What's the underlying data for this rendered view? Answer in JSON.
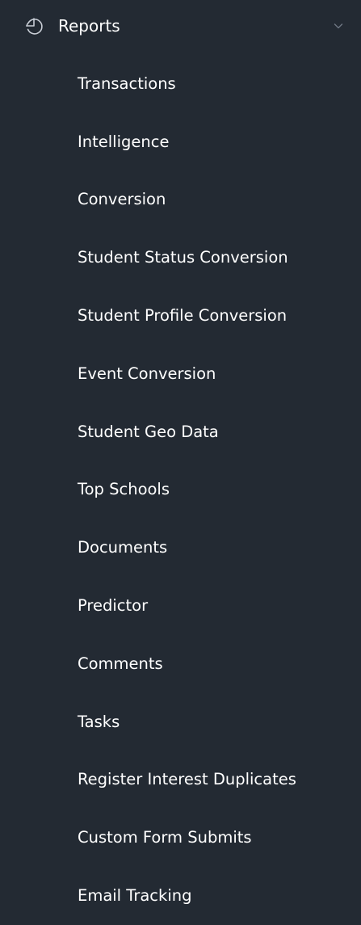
{
  "menu": {
    "header": {
      "label": "Reports",
      "icon": "pie-chart-icon",
      "expand_icon": "chevron-down-icon"
    },
    "items": [
      {
        "label": "Transactions"
      },
      {
        "label": "Intelligence"
      },
      {
        "label": "Conversion"
      },
      {
        "label": "Student Status Conversion"
      },
      {
        "label": "Student Profile Conversion"
      },
      {
        "label": "Event Conversion"
      },
      {
        "label": "Student Geo Data"
      },
      {
        "label": "Top Schools"
      },
      {
        "label": "Documents"
      },
      {
        "label": "Predictor"
      },
      {
        "label": "Comments"
      },
      {
        "label": "Tasks"
      },
      {
        "label": "Register Interest Duplicates"
      },
      {
        "label": "Custom Form Submits"
      },
      {
        "label": "Email Tracking"
      }
    ]
  },
  "colors": {
    "background": "#232a33",
    "text": "#ffffff",
    "icon": "#c9ced6",
    "chevron": "#6f7884"
  }
}
